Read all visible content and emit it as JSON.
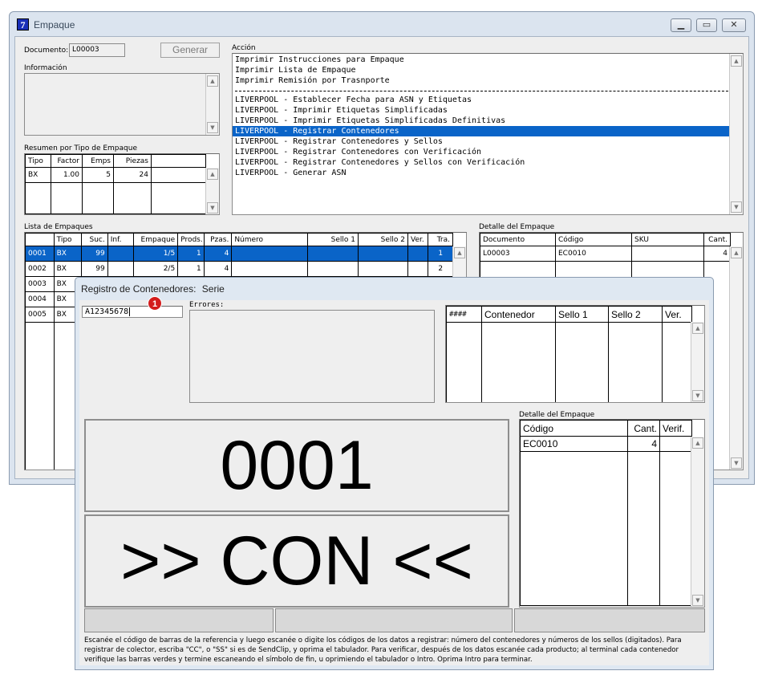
{
  "main_window": {
    "icon_glyph": "7",
    "title": "Empaque",
    "documento_label": "Documento:",
    "documento_value": "L00003",
    "generar_label": "Generar",
    "informacion_label": "Información",
    "accion_label": "Acción",
    "actions_group1": [
      "Imprimir Instrucciones para Empaque",
      "Imprimir Lista de Empaque",
      "Imprimir Remisión por Trasnporte"
    ],
    "actions_group2": [
      "LIVERPOOL - Establecer Fecha para ASN y Etiquetas",
      "LIVERPOOL - Imprimir Etiquetas Simplificadas",
      "LIVERPOOL - Imprimir Etiquetas Simplificadas Definitivas",
      "LIVERPOOL - Registrar Contenedores",
      "LIVERPOOL - Registrar Contenedores y Sellos",
      "LIVERPOOL - Registrar Contenedores con Verificación",
      "LIVERPOOL - Registrar Contenedores y Sellos con Verificación",
      "LIVERPOOL - Generar ASN"
    ],
    "selected_action": "LIVERPOOL - Registrar Contenedores",
    "resumen": {
      "label": "Resumen por Tipo de Empaque",
      "headers": [
        "Tipo",
        "Factor",
        "Emps",
        "Piezas"
      ],
      "rows": [
        [
          "BX",
          "1.00",
          "5",
          "24"
        ]
      ]
    },
    "lista": {
      "label": "Lista de Empaques",
      "headers": [
        "",
        "Tipo",
        "Suc.",
        "Inf.",
        "Empaque",
        "Prods.",
        "Pzas.",
        "Número",
        "Sello 1",
        "Sello 2",
        "Ver.",
        "Tra."
      ],
      "rows": [
        [
          "0001",
          "BX",
          "99",
          "",
          "1/5",
          "1",
          "4",
          "",
          "",
          "",
          "",
          "1"
        ],
        [
          "0002",
          "BX",
          "99",
          "",
          "2/5",
          "1",
          "4",
          "",
          "",
          "",
          "",
          "2"
        ],
        [
          "0003",
          "BX",
          "",
          "",
          "",
          "",
          "",
          "",
          "",
          "",
          "",
          ""
        ],
        [
          "0004",
          "BX",
          "",
          "",
          "",
          "",
          "",
          "",
          "",
          "",
          "",
          ""
        ],
        [
          "0005",
          "BX",
          "",
          "",
          "",
          "",
          "",
          "",
          "",
          "",
          "",
          ""
        ]
      ]
    },
    "detalle": {
      "label": "Detalle del Empaque",
      "headers": [
        "Documento",
        "Código",
        "SKU",
        "Cant."
      ],
      "rows": [
        [
          "L00003",
          "EC0010",
          "",
          "4"
        ]
      ]
    }
  },
  "dialog": {
    "title": "Registro de Contenedores:",
    "subtitle": "Serie",
    "scan_value": "A12345678",
    "marker": "1",
    "errores_label": "Errores:",
    "contenedores": {
      "headers": [
        "####",
        "Contenedor",
        "Sello 1",
        "Sello 2",
        "Ver."
      ]
    },
    "detalle_label": "Detalle del Empaque",
    "detalle": {
      "headers": [
        "Código",
        "Cant.",
        "Verif."
      ],
      "rows": [
        [
          "EC0010",
          "4",
          ""
        ]
      ]
    },
    "big_number": "0001",
    "big_status": ">> CON <<",
    "instructions": "Escanée el código de barras de la referencia y luego escanée o digite los códigos de los datos a registrar: número del contenedores y números de los sellos (digitados). Para registrar de colector, escriba \"CC\", o \"SS\" si es de SendClip, y oprima el tabulador. Para verificar, después de los datos escanée cada producto; al terminal cada contenedor verifique las barras verdes y termine escaneando el símbolo de fin, u oprimiendo el tabulador o Intro. Oprima Intro para terminar."
  }
}
